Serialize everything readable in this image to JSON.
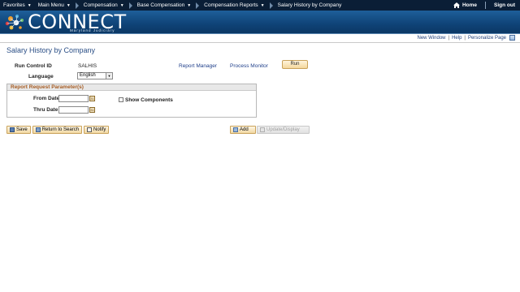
{
  "nav": {
    "items": [
      {
        "label": "Favorites"
      },
      {
        "label": "Main Menu"
      },
      {
        "label": "Compensation"
      },
      {
        "label": "Base Compensation"
      },
      {
        "label": "Compensation Reports"
      },
      {
        "label": "Salary History by Company"
      }
    ],
    "home": "Home",
    "signout": "Sign out"
  },
  "banner": {
    "logo_text": "CONNECT",
    "logo_sub": "Maryland Judiciary"
  },
  "util_links": {
    "new_window": "New Window",
    "help": "Help",
    "personalize": "Personalize Page"
  },
  "page": {
    "title": "Salary History by Company",
    "run_control_label": "Run Control ID",
    "run_control_value": "SALHIS",
    "report_manager": "Report Manager",
    "process_monitor": "Process Monitor",
    "run": "Run",
    "language_label": "Language",
    "language_value": "English"
  },
  "params": {
    "header": "Report Request Parameter(s)",
    "from_date_label": "From Date",
    "thru_date_label": "Thru Date",
    "show_components": "Show Components"
  },
  "toolbar": {
    "save": "Save",
    "return_to_search": "Return to Search",
    "notify": "Notify",
    "add": "Add",
    "update_display": "Update/Display"
  },
  "colors": {
    "nav_bg": "#0a1e36",
    "banner": "#0f4377",
    "title": "#2b4f86",
    "group_header": "#a55b22"
  }
}
